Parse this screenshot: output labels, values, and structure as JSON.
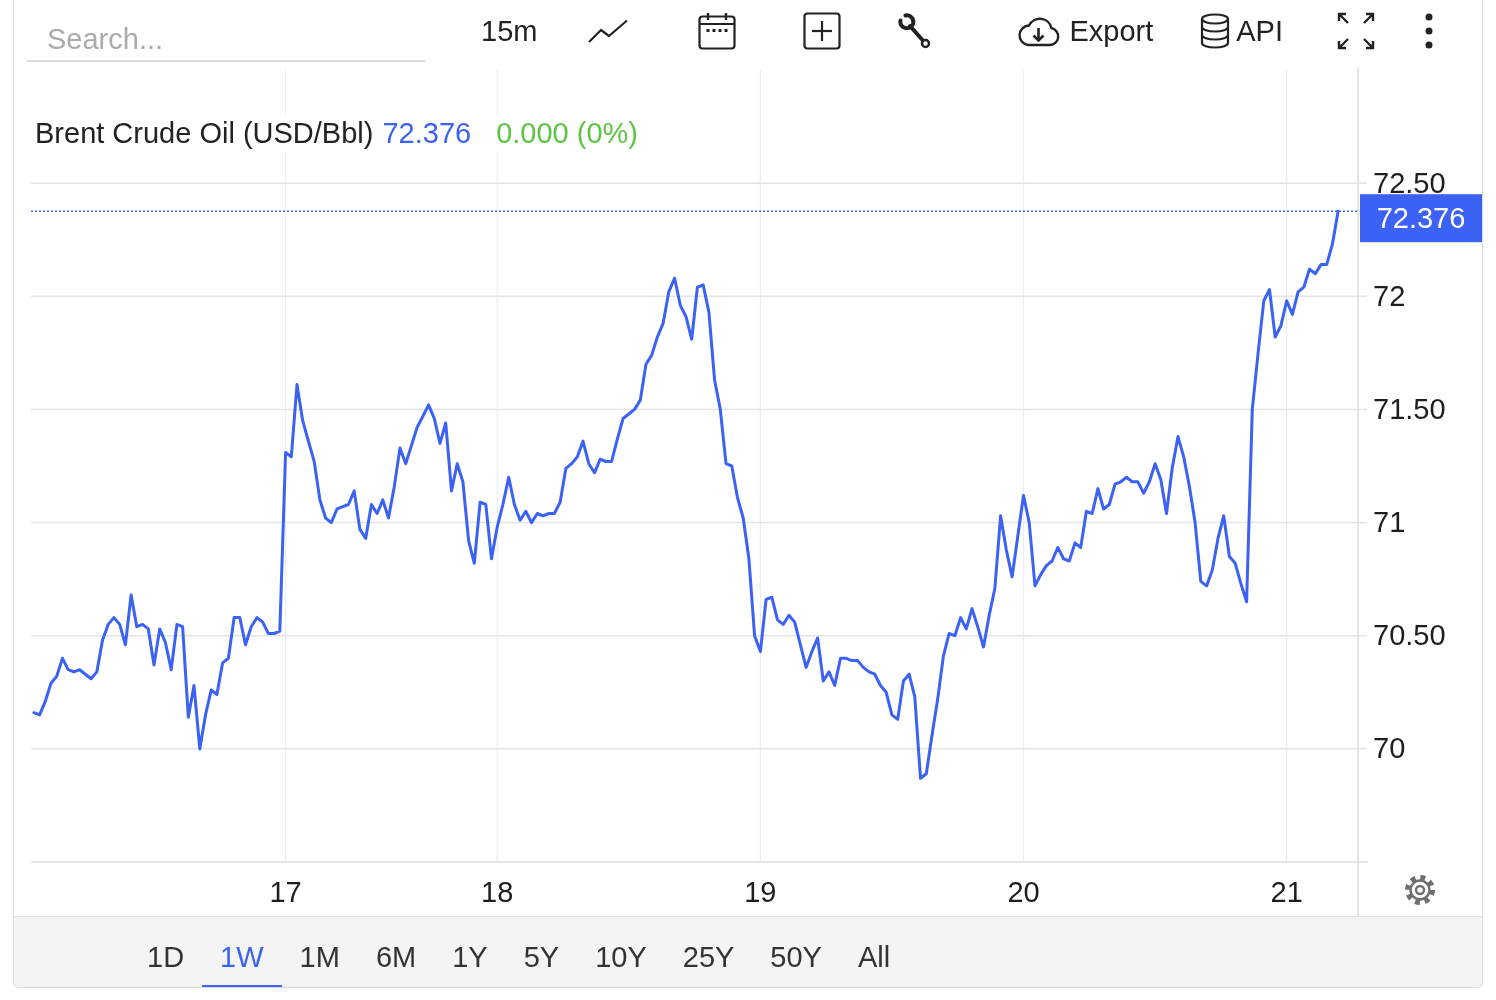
{
  "toolbar": {
    "search": {
      "placeholder": "Search..."
    },
    "interval": "15m",
    "export": "Export",
    "api": "API"
  },
  "chart": {
    "legend": {
      "price": "72.376",
      "change": "0.000 (0%)"
    },
    "chart_data": {
      "type": "line",
      "grid": true,
      "categories": [
        null,
        null,
        null,
        null,
        null,
        null,
        null,
        null,
        null,
        null,
        null,
        null,
        null,
        null,
        null,
        null,
        null,
        null,
        null,
        null,
        null,
        null,
        null,
        null,
        null,
        null,
        null,
        null,
        null,
        null,
        null,
        null,
        null,
        null,
        null,
        null,
        null,
        null,
        null,
        null,
        null,
        null,
        null,
        null,
        "17",
        null,
        null,
        null,
        null,
        null,
        null,
        null,
        null,
        null,
        null,
        null,
        null,
        null,
        null,
        null,
        null,
        null,
        null,
        null,
        null,
        null,
        null,
        null,
        null,
        null,
        null,
        null,
        null,
        null,
        null,
        null,
        null,
        null,
        null,
        null,
        null,
        "18",
        null,
        null,
        null,
        null,
        null,
        null,
        null,
        null,
        null,
        null,
        null,
        null,
        null,
        null,
        null,
        null,
        null,
        null,
        null,
        null,
        null,
        null,
        null,
        null,
        null,
        null,
        null,
        null,
        null,
        null,
        null,
        null,
        null,
        null,
        null,
        null,
        null,
        null,
        null,
        null,
        null,
        null,
        null,
        null,
        null,
        "19",
        null,
        null,
        null,
        null,
        null,
        null,
        null,
        null,
        null,
        null,
        null,
        null,
        null,
        null,
        null,
        null,
        null,
        null,
        null,
        null,
        null,
        null,
        null,
        null,
        null,
        null,
        null,
        null,
        null,
        null,
        null,
        null,
        null,
        null,
        null,
        null,
        null,
        null,
        null,
        null,
        null,
        null,
        null,
        null,
        null,
        "20",
        null,
        null,
        null,
        null,
        null,
        null,
        null,
        null,
        null,
        null,
        null,
        null,
        null,
        null,
        null,
        null,
        null,
        null,
        null,
        null,
        null,
        null,
        null,
        null,
        null,
        null,
        null,
        null,
        null,
        null,
        null,
        null,
        null,
        null,
        null,
        null,
        null,
        null,
        null,
        null,
        null,
        null,
        null,
        null,
        null,
        "21",
        null,
        null,
        null,
        null,
        null,
        null,
        null,
        null,
        null
      ],
      "series": [
        {
          "name": "Brent Crude Oil (USD/Bbl)",
          "color": "#3b62f4",
          "values": [
            70.16,
            70.15,
            70.21,
            70.29,
            70.32,
            70.4,
            70.35,
            70.34,
            70.35,
            70.33,
            70.31,
            70.34,
            70.48,
            70.55,
            70.58,
            70.55,
            70.46,
            70.68,
            70.54,
            70.55,
            70.53,
            70.37,
            70.53,
            70.47,
            70.35,
            70.55,
            70.54,
            70.14,
            70.28,
            70.0,
            70.15,
            70.26,
            70.24,
            70.38,
            70.4,
            70.58,
            70.58,
            70.46,
            70.54,
            70.58,
            70.56,
            70.51,
            70.51,
            70.52,
            71.31,
            71.29,
            71.61,
            71.45,
            71.36,
            71.27,
            71.1,
            71.02,
            71.0,
            71.06,
            71.07,
            71.08,
            71.14,
            70.97,
            70.93,
            71.08,
            71.04,
            71.1,
            71.02,
            71.16,
            71.33,
            71.26,
            71.34,
            71.42,
            71.47,
            71.52,
            71.46,
            71.35,
            71.44,
            71.14,
            71.26,
            71.18,
            70.92,
            70.82,
            71.09,
            71.08,
            70.84,
            70.98,
            71.08,
            71.2,
            71.08,
            71.01,
            71.05,
            71.0,
            71.04,
            71.03,
            71.04,
            71.04,
            71.09,
            71.24,
            71.26,
            71.29,
            71.36,
            71.26,
            71.22,
            71.28,
            71.27,
            71.27,
            71.37,
            71.46,
            71.48,
            71.5,
            71.54,
            71.7,
            71.74,
            71.82,
            71.88,
            72.02,
            72.08,
            71.96,
            71.91,
            71.81,
            72.04,
            72.05,
            71.93,
            71.63,
            71.5,
            71.26,
            71.25,
            71.11,
            71.02,
            70.84,
            70.5,
            70.43,
            70.66,
            70.67,
            70.57,
            70.55,
            70.59,
            70.56,
            70.46,
            70.36,
            70.43,
            70.49,
            70.3,
            70.34,
            70.28,
            70.4,
            70.4,
            70.39,
            70.39,
            70.36,
            70.34,
            70.33,
            70.28,
            70.25,
            70.15,
            70.13,
            70.3,
            70.33,
            70.23,
            69.87,
            69.89,
            70.06,
            70.22,
            70.41,
            70.51,
            70.5,
            70.58,
            70.53,
            70.62,
            70.54,
            70.45,
            70.59,
            70.71,
            71.03,
            70.88,
            70.76,
            70.94,
            71.12,
            71.0,
            70.72,
            70.77,
            70.81,
            70.83,
            70.89,
            70.84,
            70.83,
            70.91,
            70.89,
            71.05,
            71.04,
            71.15,
            71.06,
            71.08,
            71.17,
            71.18,
            71.2,
            71.18,
            71.18,
            71.13,
            71.18,
            71.26,
            71.19,
            71.04,
            71.24,
            71.38,
            71.29,
            71.16,
            71.0,
            70.74,
            70.72,
            70.79,
            70.93,
            71.03,
            70.85,
            70.82,
            70.73,
            70.65,
            71.5,
            71.75,
            71.98,
            72.03,
            71.82,
            71.87,
            71.98,
            71.92,
            72.02,
            72.04,
            72.12,
            72.1,
            72.14,
            72.14,
            72.23,
            72.376
          ]
        }
      ],
      "ref_lines": [
        {
          "axis": "y",
          "value": 72.376,
          "label": "72.376",
          "color": "#3b62f4"
        }
      ],
      "ylim": [
        69.5,
        73
      ],
      "yticks": [
        {
          "value": 70,
          "label": "70"
        },
        {
          "value": 70.5,
          "label": "70.50"
        },
        {
          "value": 71,
          "label": "71"
        },
        {
          "value": 71.5,
          "label": "71.50"
        },
        {
          "value": 72,
          "label": "72"
        },
        {
          "value": 72.5,
          "label": "72.50"
        }
      ]
    }
  },
  "ranges": [
    {
      "label": "1D",
      "selected": false
    },
    {
      "label": "1W",
      "selected": true
    },
    {
      "label": "1M",
      "selected": false
    },
    {
      "label": "6M",
      "selected": false
    },
    {
      "label": "1Y",
      "selected": false
    },
    {
      "label": "5Y",
      "selected": false
    },
    {
      "label": "10Y",
      "selected": false
    },
    {
      "label": "25Y",
      "selected": false
    },
    {
      "label": "50Y",
      "selected": false
    },
    {
      "label": "All",
      "selected": false
    }
  ]
}
